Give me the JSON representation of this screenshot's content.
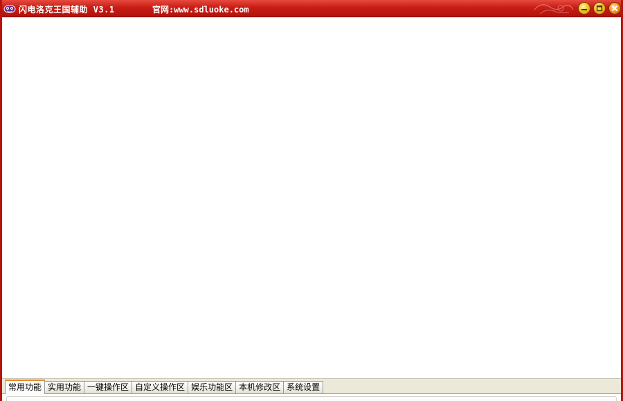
{
  "window": {
    "title": "闪电洛克王国辅助 V3.1",
    "site": "官网:www.sdluoke.com",
    "accent": "#c81d15"
  },
  "icons": {
    "app": "app-logo-icon",
    "minimize": "minimize-icon",
    "maximize": "maximize-icon",
    "close": "close-icon"
  },
  "tabs": [
    {
      "label": "常用功能",
      "active": true
    },
    {
      "label": "实用功能",
      "active": false
    },
    {
      "label": "一键操作区",
      "active": false
    },
    {
      "label": "自定义操作区",
      "active": false
    },
    {
      "label": "娱乐功能区",
      "active": false
    },
    {
      "label": "本机修改区",
      "active": false
    },
    {
      "label": "系统设置",
      "active": false
    }
  ]
}
